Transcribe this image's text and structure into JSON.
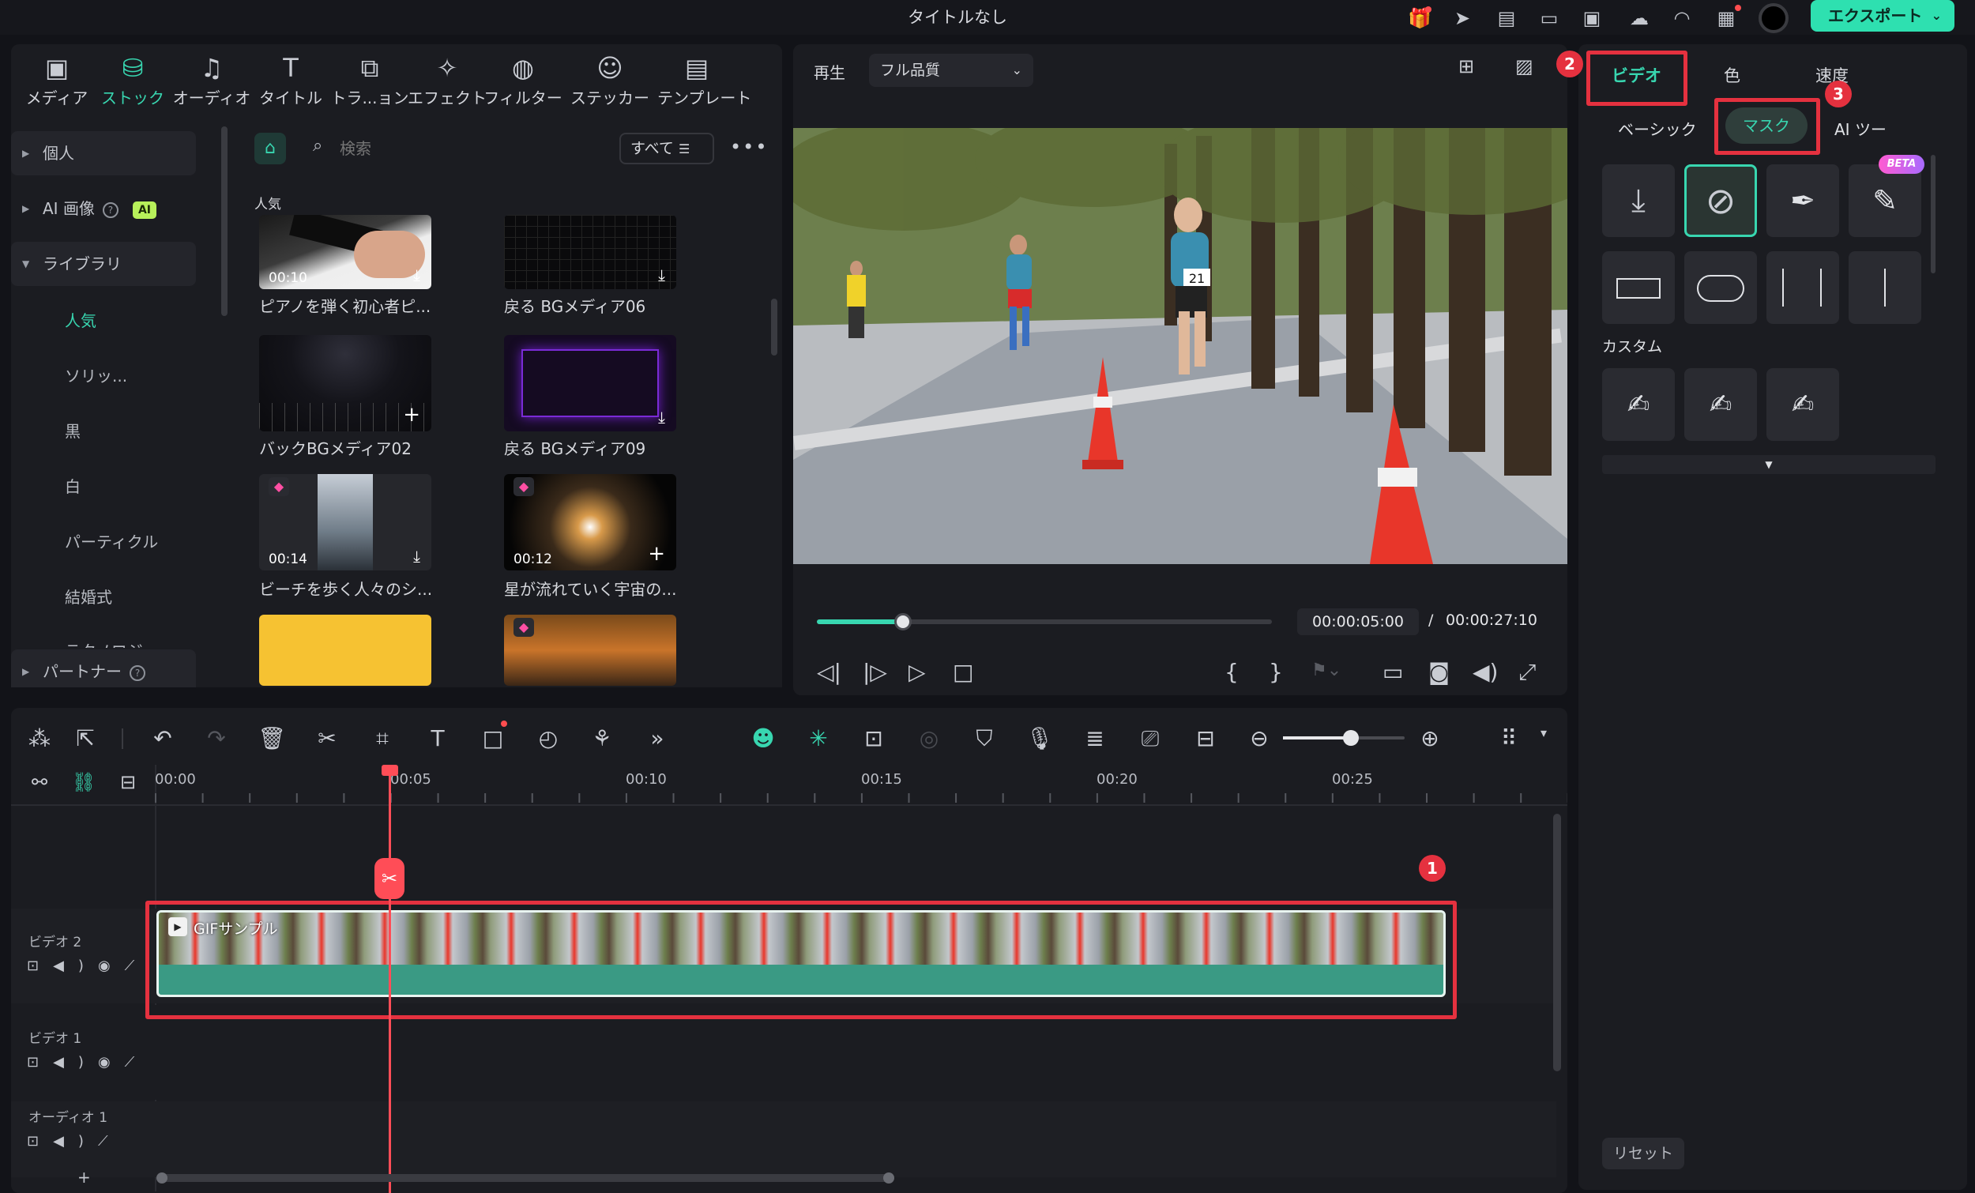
{
  "window": {
    "title": "タイトルなし",
    "export_label": "エクスポート"
  },
  "media_tabs": [
    {
      "label": "メディア",
      "icon": "media-icon"
    },
    {
      "label": "ストック",
      "icon": "stock-icon",
      "active": true
    },
    {
      "label": "オーディオ",
      "icon": "music-note-icon"
    },
    {
      "label": "タイトル",
      "icon": "title-t-icon"
    },
    {
      "label": "トラ...ョン",
      "icon": "transition-icon"
    },
    {
      "label": "エフェクト",
      "icon": "effect-icon"
    },
    {
      "label": "フィルター",
      "icon": "filter-icon"
    },
    {
      "label": "ステッカー",
      "icon": "sticker-icon"
    },
    {
      "label": "テンプレート",
      "icon": "template-icon"
    }
  ],
  "sidebar": {
    "personal": "個人",
    "ai_image": "AI 画像",
    "ai_badge": "AI",
    "library": "ライブラリ",
    "sub_items": [
      "人気",
      "ソリッ...",
      "黒",
      "白",
      "パーティクル",
      "結婚式",
      "テクノロジ"
    ],
    "partner": "パートナー"
  },
  "search": {
    "placeholder": "検索",
    "filter_label": "すべて"
  },
  "section_title": "人気",
  "media_items": [
    {
      "label": "ピアノを弾く初心者ピ...",
      "duration": "00:10"
    },
    {
      "label": "戻る BGメディア06",
      "duration": ""
    },
    {
      "label": "バックBGメディア02",
      "duration": ""
    },
    {
      "label": "戻る BGメディア09",
      "duration": ""
    },
    {
      "label": "ビーチを歩く人々のシ...",
      "duration": "00:14"
    },
    {
      "label": "星が流れていく宇宙の...",
      "duration": "00:12"
    }
  ],
  "preview": {
    "play_label": "再生",
    "quality": "フル品質",
    "current_time": "00:00:05:00",
    "separator": "/",
    "total_time": "00:00:27:10",
    "progress": 0.19,
    "bib_number": "21"
  },
  "props": {
    "tabs": [
      "ビデオ",
      "色",
      "速度"
    ],
    "subtabs": [
      "ベーシック",
      "マスク",
      "AI ツー"
    ],
    "beta": "BETA",
    "custom_label": "カスタム",
    "reset_label": "リセット",
    "badges": [
      "1",
      "2",
      "3"
    ]
  },
  "timeline": {
    "ticks": [
      "00:00",
      "00:05",
      "00:10",
      "00:15",
      "00:20",
      "00:25"
    ],
    "tracks": [
      "ビデオ 2",
      "ビデオ 1",
      "オーディオ 1"
    ],
    "clip_label": "GIFサンプル",
    "add_track": "+"
  },
  "colors": {
    "accent": "#38d6b0",
    "highlight": "#e5313f",
    "clip": "#3a9a84"
  }
}
